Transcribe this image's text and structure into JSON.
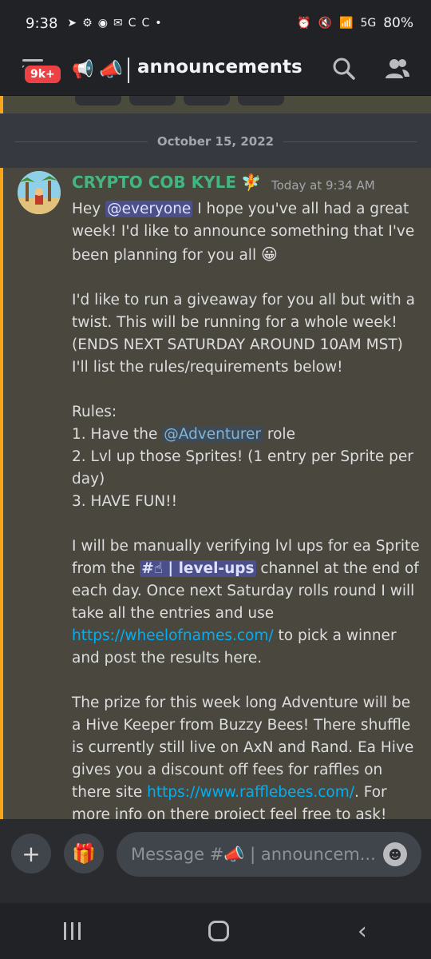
{
  "status_bar": {
    "time": "9:38",
    "left_icons": [
      "➤",
      "⚙",
      "◉",
      "✉",
      "C",
      "C",
      "•"
    ],
    "right_icons": [
      "⏰",
      "🔇",
      "📶",
      "5G"
    ],
    "battery": "80%"
  },
  "header": {
    "badge": "9k+",
    "channel_emoji": "📣",
    "channel_name": "announcements"
  },
  "chat": {
    "date_divider": "October 15, 2022",
    "message": {
      "author": "CRYPTO COB KYLE",
      "author_badge": "🧚",
      "timestamp": "Today at 9:34 AM",
      "p1_pre": "Hey ",
      "p1_mention": "@everyone",
      "p1_post": " I hope you've all had a great week! I'd like to announce something that I've been planning for you all ",
      "p1_emoji": "😀",
      "p2": "I'd like to run a giveaway for you all but with a twist. This will be running for a whole week! (ENDS NEXT SATURDAY AROUND 10AM MST) I'll list the rules/requirements below!",
      "rules_title": "Rules:",
      "rule1_pre": "1. Have the ",
      "rule1_role": "@Adventurer",
      "rule1_post": " role",
      "rule2": "2. Lvl up those Sprites! (1 entry per Sprite per day)",
      "rule3": "3. HAVE FUN!!",
      "p4_pre": "I will be manually verifying lvl ups for ea Sprite from the ",
      "p4_channel": "#☝ | level-ups",
      "p4_mid": " channel at the end of each day. Once next Saturday rolls round I will take all the entries and use ",
      "p4_link": "https://wheelofnames.com/",
      "p4_post": " to pick a winner and post the results here.",
      "p5_pre": "The prize for this week long Adventure will be a Hive Keeper from Buzzy Bees! There shuffle is currently still live on AxN and Rand. Ea Hive gives you a discount off fees for raffles on there site ",
      "p5_link": "https://www.rafflebees.com/",
      "p5_post": ". For more info on there project feel free to ask! Happy Adventures Everyone! ",
      "p5_emojis": "😊💚"
    }
  },
  "composer": {
    "add_label": "+",
    "gift_label": "🎁",
    "placeholder": "Message #📣 | announcem...",
    "emoji_label": "☻"
  },
  "colors": {
    "background": "#36393f",
    "highlight_message": "#4a473e",
    "accent_bar": "#faa61a",
    "author": "#43b581",
    "link": "#00aff4",
    "badge": "#ed4245"
  }
}
